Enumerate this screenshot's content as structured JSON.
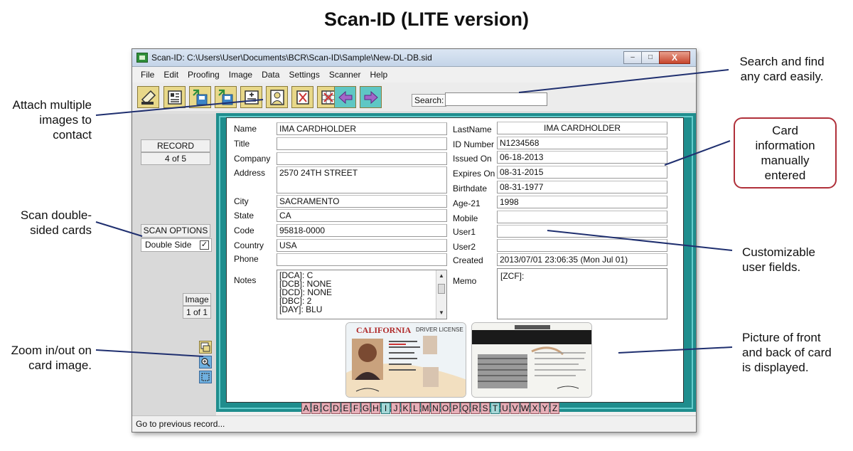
{
  "page_title": "Scan-ID (LITE version)",
  "callouts": {
    "attach": "Attach multiple images to contact",
    "scan": "Scan double-sided cards",
    "zoom": "Zoom in/out on card image.",
    "search": "Search and find any card easily.",
    "card_info": "Card information manually entered",
    "custom": "Customizable user fields.",
    "picture": "Picture of front and back of card is displayed."
  },
  "window": {
    "title": "Scan-ID: C:\\Users\\User\\Documents\\BCR\\Scan-ID\\Sample\\New-DL-DB.sid",
    "close_label": "X"
  },
  "menu": [
    "File",
    "Edit",
    "Proofing",
    "Image",
    "Data",
    "Settings",
    "Scanner",
    "Help"
  ],
  "toolbar": {
    "buttons": [
      "scanner-icon",
      "card-view-icon",
      "export-icon",
      "save-icon",
      "add-image-icon",
      "contact-photo-icon",
      "delete-image-icon",
      "grid-delete-icon",
      "previous-record-icon",
      "next-record-icon"
    ],
    "search_label": "Search:",
    "search_value": ""
  },
  "left_panel": {
    "record_label": "RECORD",
    "record_count": "4  of  5",
    "scan_options_label": "SCAN OPTIONS",
    "double_side_label": "Double Side",
    "double_side_checked": true,
    "check_mark": "✓",
    "image_label": "Image",
    "image_count": "1 of 1"
  },
  "form": {
    "labels": {
      "name": "Name",
      "title": "Title",
      "company": "Company",
      "address": "Address",
      "city": "City",
      "state": "State",
      "code": "Code",
      "country": "Country",
      "phone": "Phone",
      "notes": "Notes",
      "lastname": "LastName",
      "id_number": "ID Number",
      "issued_on": "Issued On",
      "expires_on": "Expires On",
      "birthdate": "Birthdate",
      "age21": "Age-21",
      "mobile": "Mobile",
      "user1": "User1",
      "user2": "User2",
      "created": "Created",
      "memo": "Memo"
    },
    "values": {
      "name": "IMA CARDHOLDER",
      "title": "",
      "company": "",
      "address": "2570 24TH STREET",
      "city": "SACRAMENTO",
      "state": "CA",
      "code": "95818-0000",
      "country": "USA",
      "phone": "",
      "lastname": "IMA CARDHOLDER",
      "id_number": "N1234568",
      "issued_on": "06-18-2013",
      "expires_on": "08-31-2015",
      "birthdate": "08-31-1977",
      "age21": "1998",
      "mobile": "",
      "user1": "",
      "user2": "",
      "created": "2013/07/01 23:06:35 (Mon Jul 01)",
      "memo": "[ZCF]:"
    },
    "notes_lines": [
      "[DCA]: C",
      "[DCB]: NONE",
      "[DCD]: NONE",
      "[DBC]: 2",
      "[DAY]: BLU"
    ]
  },
  "card_images": {
    "front_state": "CALIFORNIA",
    "front_type": "DRIVER LICENSE"
  },
  "alphabet": [
    "A",
    "B",
    "C",
    "D",
    "E",
    "F",
    "G",
    "H",
    "I",
    "J",
    "K",
    "L",
    "M",
    "N",
    "O",
    "P",
    "Q",
    "R",
    "S",
    "T",
    "U",
    "V",
    "W",
    "X",
    "Y",
    "Z"
  ],
  "alphabet_highlight": [
    "I",
    "T"
  ],
  "status_text": "Go to previous record...",
  "colors": {
    "frame_teal": "#1f8d8d",
    "tb_yellow": "#e8d889",
    "callout_border": "#b0303a",
    "alpha_pink": "#e7b0b9"
  }
}
